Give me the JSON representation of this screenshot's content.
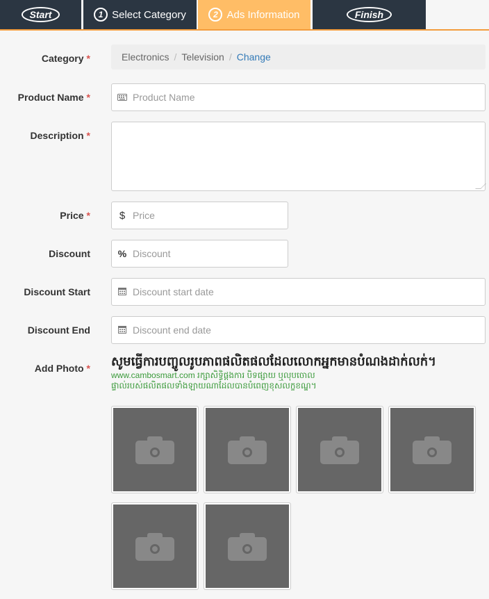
{
  "wizard": {
    "steps": [
      {
        "label": "Start",
        "number": ""
      },
      {
        "label": "Select Category",
        "number": "1"
      },
      {
        "label": "Ads Information",
        "number": "2"
      },
      {
        "label": "Finish",
        "number": ""
      }
    ],
    "active_step_index": 2
  },
  "form": {
    "required_mark": "*",
    "category": {
      "label": "Category",
      "path": [
        "Electronics",
        "Television"
      ],
      "separator": "/",
      "change_link": "Change"
    },
    "product_name": {
      "label": "Product Name",
      "placeholder": "Product Name",
      "icon": "keyboard-icon"
    },
    "description": {
      "label": "Description",
      "value": ""
    },
    "price": {
      "label": "Price",
      "placeholder": "Price",
      "icon_text": "$"
    },
    "discount": {
      "label": "Discount",
      "placeholder": "Discount",
      "icon_text": "%"
    },
    "discount_start": {
      "label": "Discount Start",
      "placeholder": "Discount start date",
      "icon": "calendar-icon"
    },
    "discount_end": {
      "label": "Discount End",
      "placeholder": "Discount end date",
      "icon": "calendar-icon"
    },
    "photos": {
      "label": "Add Photo",
      "title": "សូមធ្វើការបញ្ចូលរូបភាពផលិតផលដែលលោកអ្នកមានបំណងដាក់លក់។",
      "note_line1": "www.cambosmart.com រក្សាសិទ្ធិផ្តងការ បិទផ្សាយ ឬលុបចោល",
      "note_line2": "ផ្ទាល់របស់ផលិតផលទាំងឡាយណាដែលបានបំពេញខុសលក្ខខណ្ឌ។",
      "slots": [
        "camera-icon",
        "camera-icon",
        "camera-icon",
        "camera-icon",
        "camera-icon",
        "camera-icon"
      ]
    }
  },
  "colors": {
    "nav_bg": "#2b3642",
    "active_step": "#ffbd66",
    "accent_line": "#f39c3d",
    "required": "#d9534f",
    "link": "#337ab7",
    "note_green": "#3a9a3a",
    "photo_tile": "#666666"
  }
}
